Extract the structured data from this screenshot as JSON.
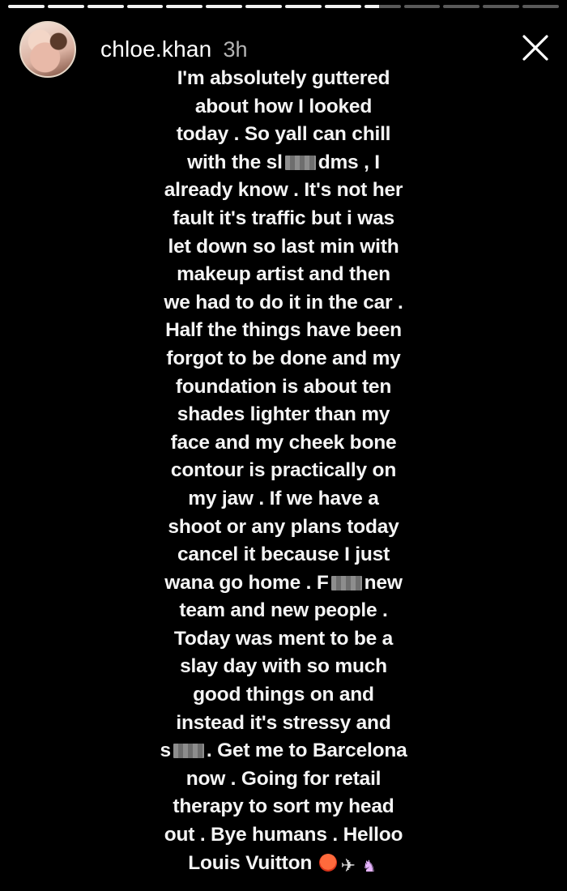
{
  "story": {
    "username": "chloe.khan",
    "timestamp": "3h",
    "segments_total": 14,
    "segments_done": 9
  },
  "icons": {
    "close": "close-icon",
    "avatar": "profile-avatar"
  },
  "caption": {
    "l1": "I'm absolutely guttered",
    "l2": "about how I looked",
    "l3": "today . So yall can chill",
    "l4a": "with the sl",
    "l4b": "dms , I",
    "l5": "already know . It's not her",
    "l6": "fault it's traffic but i was",
    "l7": "let down so last min with",
    "l8": "makeup artist and then",
    "l9": "we had to do it in the car .",
    "l10": "Half the things have been",
    "l11": "forgot to be done and my",
    "l12": "foundation is about ten",
    "l13": "shades lighter than my",
    "l14": "face and my cheek bone",
    "l15": "contour is practically on",
    "l16": "my jaw . If we have a",
    "l17": "shoot or any plans today",
    "l18": "cancel it because I just",
    "l19a": "wana go home . F",
    "l19b": "new",
    "l20": "team and new people .",
    "l21": "Today was ment to be a",
    "l22": "slay day with so much",
    "l23": "good things on and",
    "l24": "instead it's stressy and",
    "l25a": "s",
    "l25b": ". Get me to Barcelona",
    "l26": "now . Going for retail",
    "l27": "therapy to sort my head",
    "l28": "out . Bye humans . Helloo",
    "l29": "Louis Vuitton",
    "emoji1": "angry-face-emoji",
    "emoji2": "airplane-emoji",
    "emoji3": "unicorn-emoji"
  }
}
